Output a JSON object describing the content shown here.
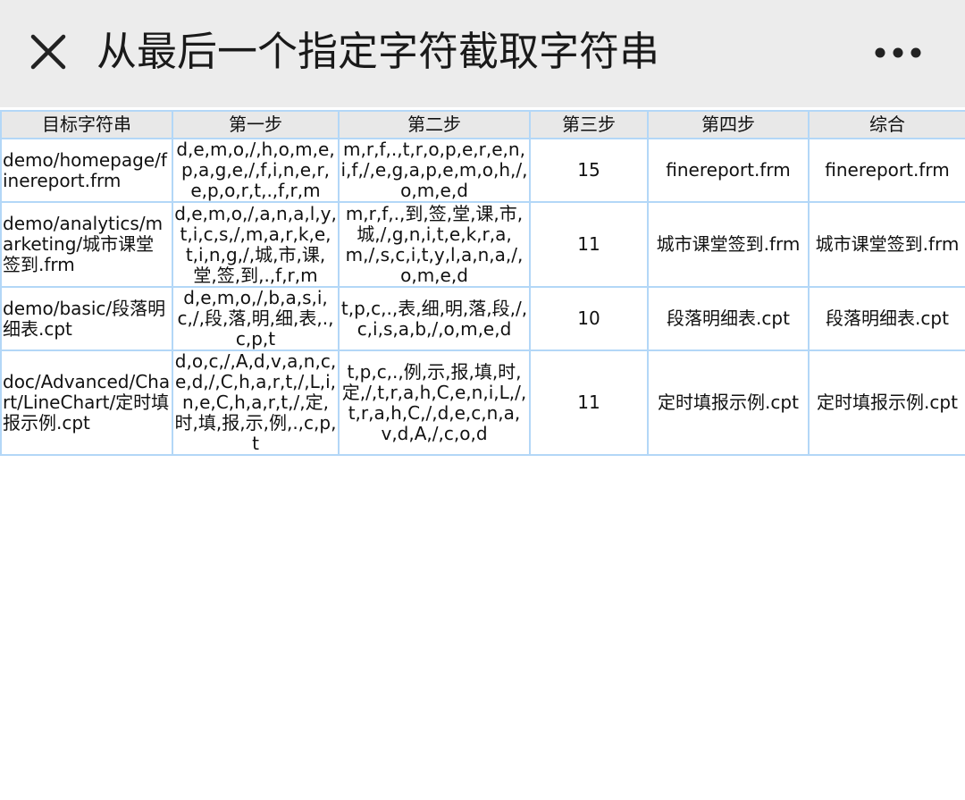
{
  "header": {
    "title": "从最后一个指定字符截取字符串",
    "close_icon": "close-icon",
    "more_icon": "more-horizontal-icon"
  },
  "table": {
    "columns": [
      "目标字符串",
      "第一步",
      "第二步",
      "第三步",
      "第四步",
      "综合"
    ],
    "rows": [
      {
        "target": "demo/homepage/finereport.frm",
        "step1": "d,e,m,o,/,h,o,m,e,p,a,g,e,/,f,i,n,e,r,e,p,o,r,t,.,f,r,m",
        "step2": "m,r,f,.,t,r,o,p,e,r,e,n,i,f,/,e,g,a,p,e,m,o,h,/,o,m,e,d",
        "step3": "15",
        "step4": "finereport.frm",
        "combined": "finereport.frm"
      },
      {
        "target": "demo/analytics/marketing/城市课堂签到.frm",
        "step1": "d,e,m,o,/,a,n,a,l,y,t,i,c,s,/,m,a,r,k,e,t,i,n,g,/,城,市,课,堂,签,到,.,f,r,m",
        "step2": "m,r,f,.,到,签,堂,课,市,城,/,g,n,i,t,e,k,r,a,m,/,s,c,i,t,y,l,a,n,a,/,o,m,e,d",
        "step3": "11",
        "step4": "城市课堂签到.frm",
        "combined": "城市课堂签到.frm"
      },
      {
        "target": "demo/basic/段落明细表.cpt",
        "step1": "d,e,m,o,/,b,a,s,i,c,/,段,落,明,细,表,.,c,p,t",
        "step2": "t,p,c,.,表,细,明,落,段,/,c,i,s,a,b,/,o,m,e,d",
        "step3": "10",
        "step4": "段落明细表.cpt",
        "combined": "段落明细表.cpt"
      },
      {
        "target": "doc/Advanced/Chart/LineChart/定时填报示例.cpt",
        "step1": "d,o,c,/,A,d,v,a,n,c,e,d,/,C,h,a,r,t,/,L,i,n,e,C,h,a,r,t,/,定,时,填,报,示,例,.,c,p,t",
        "step2": "t,p,c,.,例,示,报,填,时,定,/,t,r,a,h,C,e,n,i,L,/,t,r,a,h,C,/,d,e,c,n,a,v,d,A,/,c,o,d",
        "step3": "11",
        "step4": "定时填报示例.cpt",
        "combined": "定时填报示例.cpt"
      }
    ]
  }
}
